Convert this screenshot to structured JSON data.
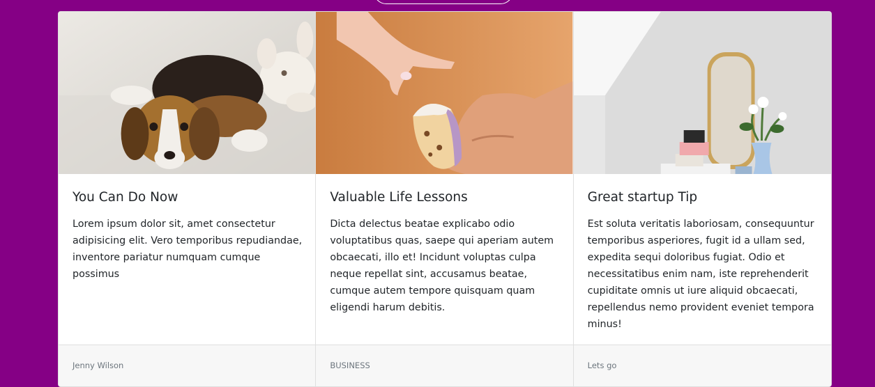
{
  "cards": [
    {
      "image": "beagle-puppy-photo",
      "title": "You Can Do Now",
      "text": "Lorem ipsum dolor sit, amet consectetur adipisicing elit. Vero temporibus repudiandae, inventore pariatur numquam cumque possimus",
      "footer": "Jenny Wilson"
    },
    {
      "image": "hands-passing-cupcake-photo",
      "title": "Valuable Life Lessons",
      "text": "Dicta delectus beatae explicabo odio voluptatibus quas, saepe qui aperiam autem obcaecati, illo et! Incidunt voluptas culpa neque repellat sint, accusamus beatae, cumque autem tempore quisquam quam eligendi harum debitis.",
      "footer": "BUSINESS"
    },
    {
      "image": "mirror-and-flowers-photo",
      "title": "Great startup Tip",
      "text": "Est soluta veritatis laboriosam, consequuntur temporibus asperiores, fugit id a ullam sed, expedita sequi doloribus fugiat. Odio et necessitatibus enim nam, iste reprehenderit cupiditate omnis ut iure aliquid obcaecati, repellendus nemo provident eveniet tempora minus!",
      "footer": "Lets go"
    }
  ],
  "colors": {
    "background": "#850085",
    "card": "#ffffff",
    "footer": "#f7f7f7"
  }
}
